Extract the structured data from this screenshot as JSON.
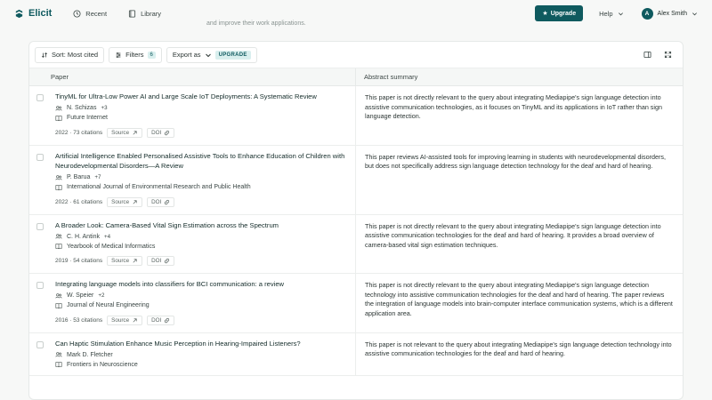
{
  "nav": {
    "brand": "Elicit",
    "recent": "Recent",
    "library": "Library",
    "upgrade": "Upgrade",
    "help": "Help",
    "user_initial": "A",
    "user_name": "Alex Smith"
  },
  "partial_text": "and improve their work applications.",
  "toolbar": {
    "sort_label": "Sort: Most cited",
    "filters_label": "Filters",
    "filters_count": "6",
    "export_label": "Export as",
    "upgrade_tag": "UPGRADE"
  },
  "columns": {
    "paper": "Paper",
    "abstract": "Abstract summary"
  },
  "labels": {
    "source": "Source",
    "doi": "DOI"
  },
  "papers": [
    {
      "title": "TinyML for Ultra-Low Power AI and Large Scale IoT Deployments: A Systematic Review",
      "author": "N. Schizas",
      "more": "+3",
      "journal": "Future Internet",
      "year_citations": "2022 · 73 citations",
      "abstract": "This paper is not directly relevant to the query about integrating Mediapipe's sign language detection into assistive communication technologies, as it focuses on TinyML and its applications in IoT rather than sign language detection."
    },
    {
      "title": "Artificial Intelligence Enabled Personalised Assistive Tools to Enhance Education of Children with Neurodevelopmental Disorders—A Review",
      "author": "P. Barua",
      "more": "+7",
      "journal": "International Journal of Environmental Research and Public Health",
      "year_citations": "2022 · 61 citations",
      "abstract": "This paper reviews AI-assisted tools for improving learning in students with neurodevelopmental disorders, but does not specifically address sign language detection technology for the deaf and hard of hearing."
    },
    {
      "title": "A Broader Look: Camera-Based Vital Sign Estimation across the Spectrum",
      "author": "C. H. Antink",
      "more": "+4",
      "journal": "Yearbook of Medical Informatics",
      "year_citations": "2019 · 54 citations",
      "abstract": "This paper is not directly relevant to the query about integrating Mediapipe's sign language detection into assistive communication technologies for the deaf and hard of hearing. It provides a broad overview of camera-based vital sign estimation techniques."
    },
    {
      "title": "Integrating language models into classifiers for BCI communication: a review",
      "author": "W. Speier",
      "more": "+2",
      "journal": "Journal of Neural Engineering",
      "year_citations": "2016 · 53 citations",
      "abstract": "This paper is not directly relevant to the query about integrating Mediapipe's sign language detection technology into assistive communication technologies for the deaf and hard of hearing. The paper reviews the integration of language models into brain-computer interface communication systems, which is a different application area."
    },
    {
      "title": "Can Haptic Stimulation Enhance Music Perception in Hearing-Impaired Listeners?",
      "author": "Mark D. Fletcher",
      "more": "",
      "journal": "Frontiers in Neuroscience",
      "year_citations": "",
      "abstract": "This paper is not relevant to the query about integrating Mediapipe's sign language detection technology into assistive communication technologies for the deaf and hard of hearing."
    }
  ]
}
